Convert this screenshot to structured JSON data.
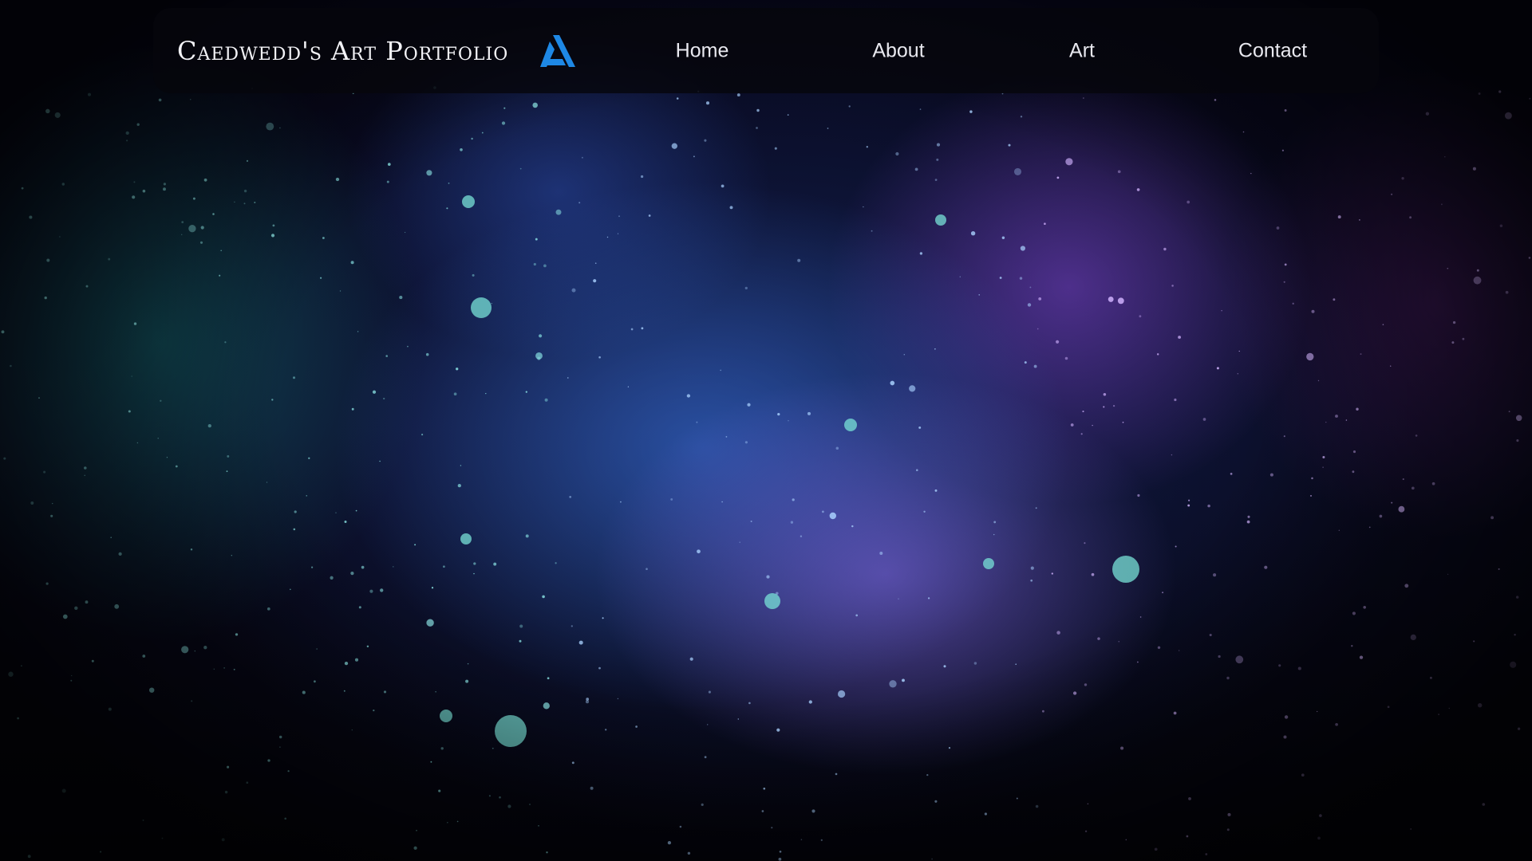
{
  "site": {
    "title": "Caedwedd's Art Portfolio",
    "logo_icon": "stylized-a-logo-icon",
    "logo_color": "#1e88e5"
  },
  "nav": {
    "items": [
      {
        "label": "Home"
      },
      {
        "label": "About"
      },
      {
        "label": "Art"
      },
      {
        "label": "Contact"
      }
    ]
  },
  "background": {
    "description_icon": "galaxy-nebula-background",
    "colors": {
      "teal": "#1a7a7a",
      "blue": "#3c78e6",
      "violet": "#8c6ef0",
      "magenta": "#5a1e6e"
    }
  }
}
